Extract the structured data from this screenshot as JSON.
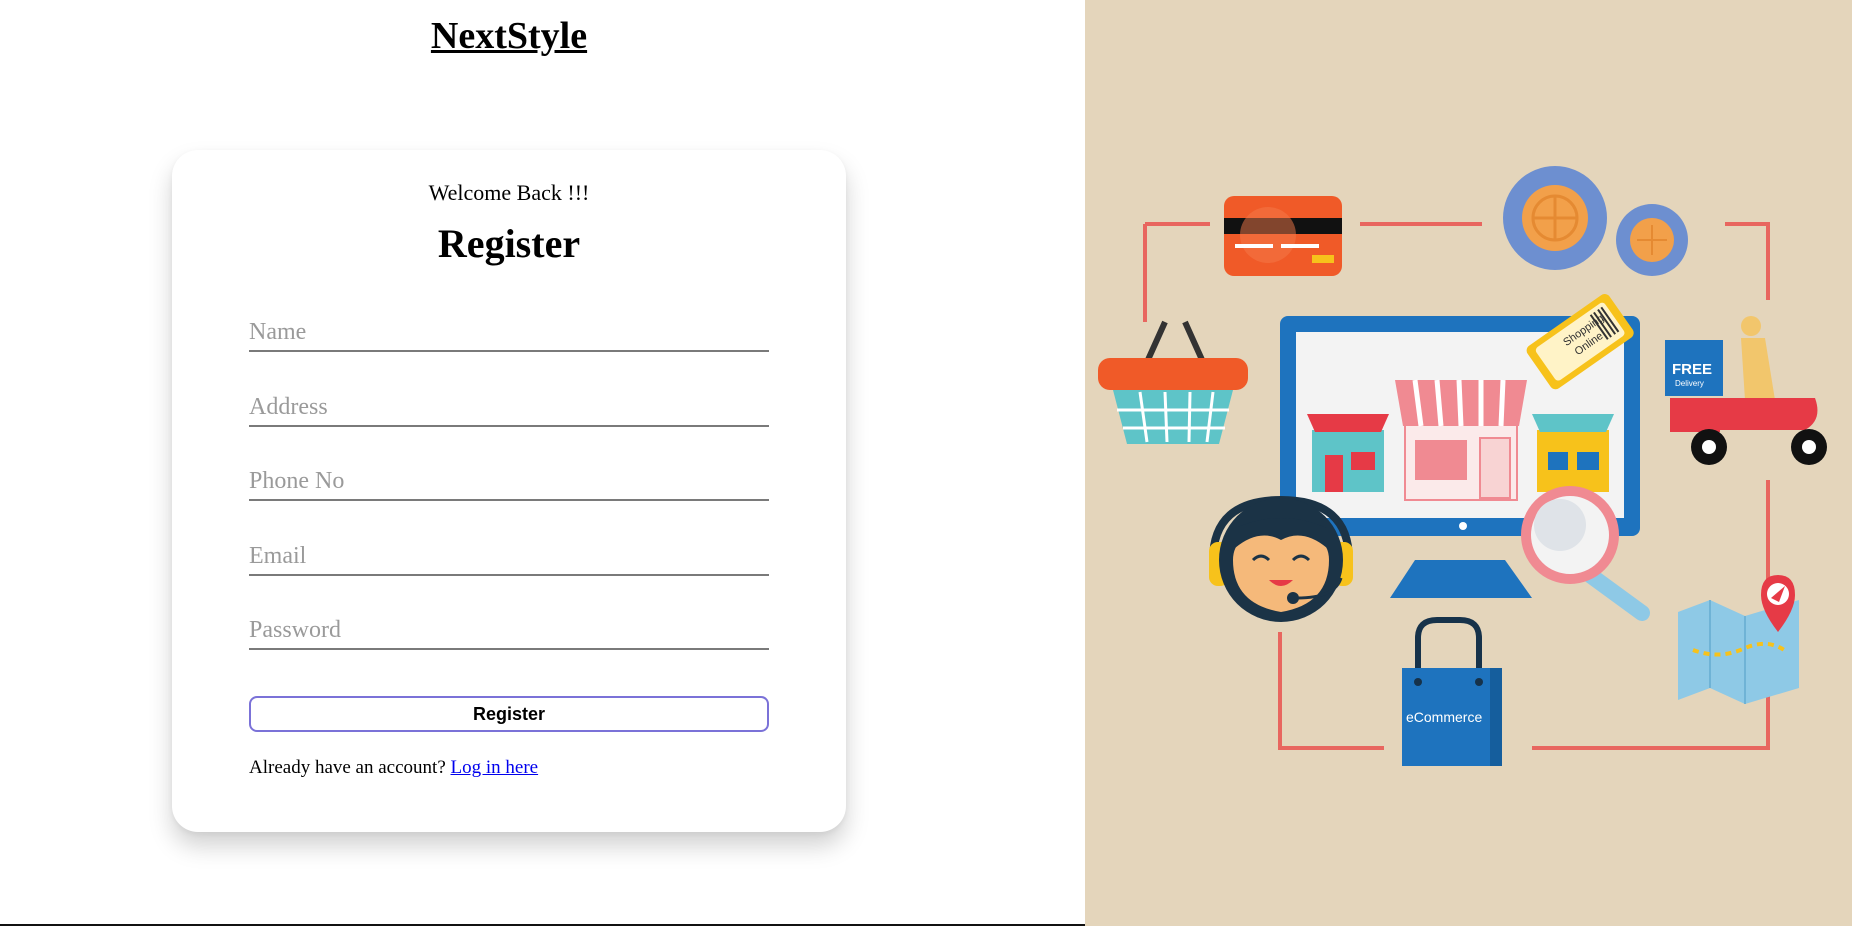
{
  "brand": {
    "name": "NextStyle"
  },
  "form": {
    "welcome": "Welcome Back !!!",
    "title": "Register",
    "fields": [
      {
        "name": "name",
        "placeholder": "Name",
        "value": ""
      },
      {
        "name": "address",
        "placeholder": "Address",
        "value": ""
      },
      {
        "name": "phone",
        "placeholder": "Phone No",
        "value": ""
      },
      {
        "name": "email",
        "placeholder": "Email",
        "value": ""
      },
      {
        "name": "password",
        "placeholder": "Password",
        "value": ""
      }
    ],
    "submit_label": "Register",
    "login_prompt": "Already have an account?",
    "login_link": "Log in here"
  },
  "illustration": {
    "shopping_tag_line1": "Shopping",
    "shopping_tag_line2": "Online",
    "delivery_badge_line1": "FREE",
    "delivery_badge_line2": "Delivery",
    "bag_label": "eCommerce",
    "colors": {
      "background": "#e4d5bb",
      "frame": "#e8665f",
      "monitor": "#1e73be",
      "gear": "#6d8fd0",
      "basket": "#f05a28"
    }
  }
}
